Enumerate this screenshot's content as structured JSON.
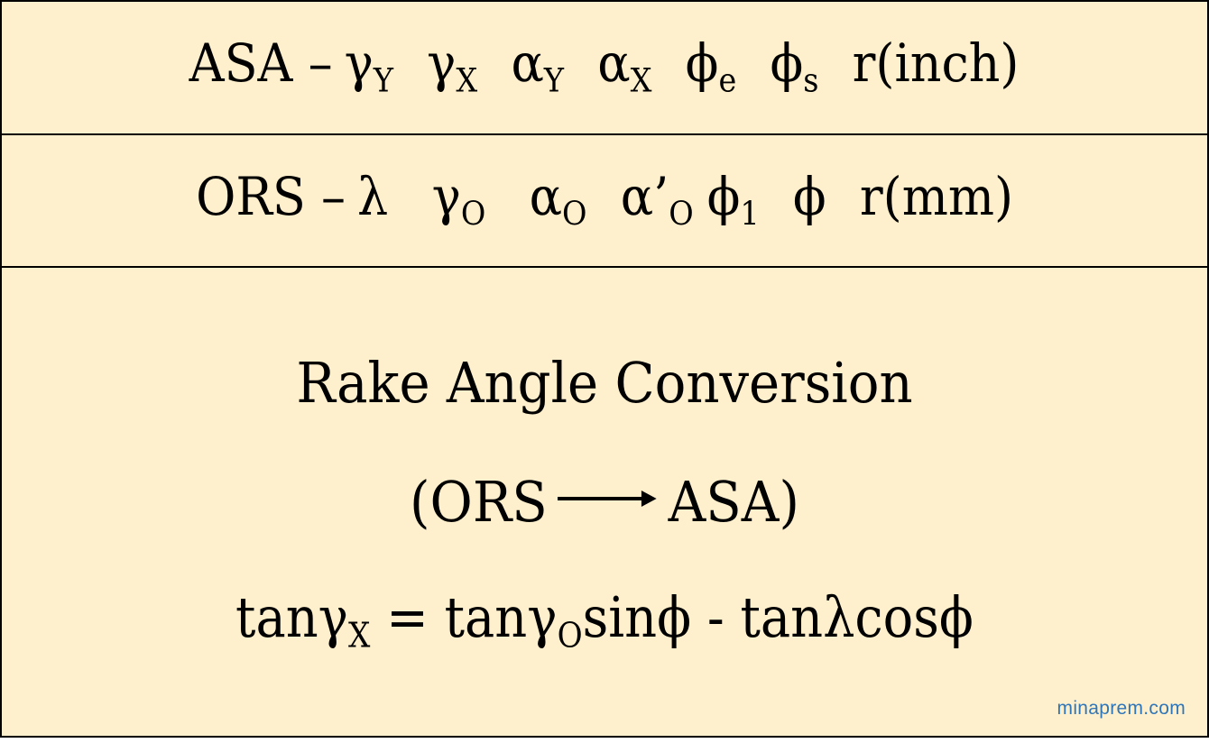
{
  "rows": [
    {
      "label": "ASA",
      "dash": "–",
      "symbols": [
        {
          "base": "γ",
          "sub": "Y",
          "prime": ""
        },
        {
          "base": "γ",
          "sub": "X",
          "prime": ""
        },
        {
          "base": "α",
          "sub": "Y",
          "prime": ""
        },
        {
          "base": "α",
          "sub": "X",
          "prime": ""
        },
        {
          "base": "ϕ",
          "sub": "e",
          "prime": ""
        },
        {
          "base": "ϕ",
          "sub": "s",
          "prime": ""
        }
      ],
      "radius": "r(inch)"
    },
    {
      "label": "ORS",
      "dash": "–",
      "symbols": [
        {
          "base": "λ",
          "sub": "",
          "prime": ""
        },
        {
          "base": "γ",
          "sub": "O",
          "prime": ""
        },
        {
          "base": "α",
          "sub": "O",
          "prime": ""
        },
        {
          "base": "α",
          "sub": "O",
          "prime": "’"
        },
        {
          "base": "ϕ",
          "sub": "1",
          "prime": ""
        },
        {
          "base": "ϕ",
          "sub": "",
          "prime": ""
        }
      ],
      "radius": "r(mm)"
    }
  ],
  "panel": {
    "title": "Rake Angle Conversion",
    "direction": {
      "open": "(",
      "from": "ORS",
      "arrow_icon": "right-arrow",
      "to": "ASA",
      "close": ")"
    },
    "formula": {
      "lhs_fn": "tan",
      "lhs_sym": "γ",
      "lhs_sub": "X",
      "equals": " = ",
      "t1_fn": "tan",
      "t1_sym": "γ",
      "t1_sub": "O",
      "t1_trig": "sinϕ",
      "minus": " - ",
      "t2": "tanλcosϕ"
    }
  },
  "watermark": "minaprem.com",
  "colors": {
    "background": "#fff0cd",
    "border": "#000000",
    "text": "#000000",
    "watermark": "#2f76b9"
  }
}
